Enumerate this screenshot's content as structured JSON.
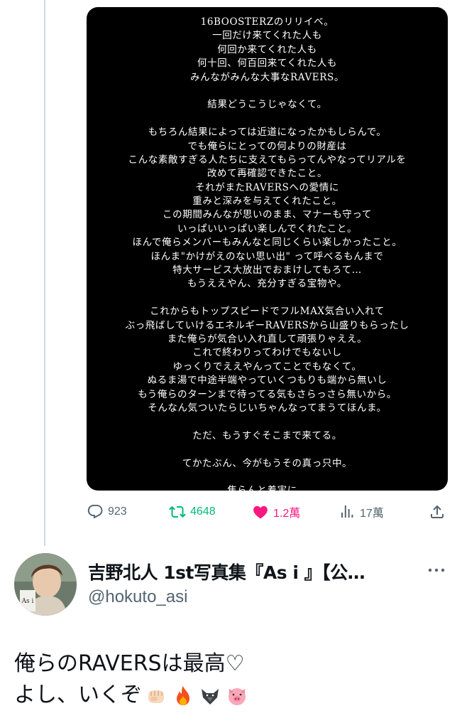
{
  "image_text": [
    "16BOOSTERZのリリイベ。",
    "一回だけ来てくれた人も",
    "何回か来てくれた人も",
    "何十回、何百回来てくれた人も",
    "みんながみんな大事なRAVERS。",
    "",
    "結果どうこうじゃなくて。",
    "",
    "もちろん結果によっては近道になったかもしらんで。",
    "でも俺らにとっての何よりの財産は",
    "こんな素敵すぎる人たちに支えてもらってんやなってリアルを",
    "改めて再確認できたこと。",
    "それがまたRAVERSへの愛情に",
    "重みと深みを与えてくれたこと。",
    "この期間みんなが思いのまま、マナーも守って",
    "いっぱいいっぱい楽しんでくれたこと。",
    "ほんで俺らメンバーもみんなと同じくらい楽しかったこと。",
    "ほんま\"かけがえのない思い出\" って呼べるもんまで",
    "特大サービス大放出でおまけしてもろて…",
    "もうええやん、充分すぎる宝物や。",
    "",
    "これからもトップスピードでフルMAX気合い入れて",
    "ぶっ飛ばしていけるエネルギーRAVERSから山盛りもらったし",
    "また俺らが気合い入れ直して頑張りゃええ。",
    "これで終わりってわけでもないし",
    "ゆっくりでええやんってことでもなくて。",
    "ぬるま湯で中途半端やっていくつもりも端から無いし",
    "もう俺らのターンまで待ってる気もさらっさら無いから。",
    "そんなん気ついたらじいちゃんなってまうてほんま。",
    "",
    "ただ、もうすぐそこまで来てる。",
    "",
    "てかたぶん、今がもうその真っ只中。",
    "",
    "焦らんと着実に。"
  ],
  "actions": {
    "replies": "923",
    "retweets": "4648",
    "likes": "1.2萬",
    "views": "17萬"
  },
  "reply_tweet": {
    "display_name": "吉野北人 1st写真集『As i 』【公…",
    "handle": "@hokuto_asi",
    "text_line1": "俺らのRAVERSは最高♡",
    "text_line2": "よし、いくぞ",
    "emojis": [
      "fist-emoji",
      "fire-emoji",
      "wolf-emoji",
      "pig-emoji"
    ],
    "avatar_text": "As i"
  },
  "colors": {
    "retweet": "#00ba7c",
    "like": "#f91880",
    "muted": "#536471"
  }
}
